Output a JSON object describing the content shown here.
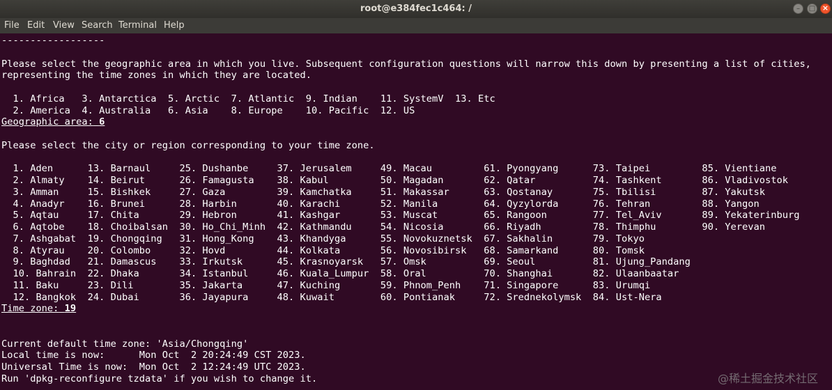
{
  "window": {
    "title": "root@e384fec1c464: /"
  },
  "menubar": {
    "items": [
      "File",
      "Edit",
      "View",
      "Search",
      "Terminal",
      "Help"
    ]
  },
  "terminal": {
    "lines": [
      "------------------",
      "",
      "Please select the geographic area in which you live. Subsequent configuration questions will narrow this down by presenting a list of cities,",
      "representing the time zones in which they are located.",
      "",
      "  1. Africa   3. Antarctica  5. Arctic  7. Atlantic  9. Indian    11. SystemV  13. Etc",
      "  2. America  4. Australia   6. Asia    8. Europe    10. Pacific  12. US",
      "",
      "",
      "Please select the city or region corresponding to your time zone.",
      "",
      "  1. Aden      13. Barnaul     25. Dushanbe     37. Jerusalem     49. Macau         61. Pyongyang      73. Taipei         85. Vientiane",
      "  2. Almaty    14. Beirut      26. Famagusta    38. Kabul         50. Magadan       62. Qatar          74. Tashkent       86. Vladivostok",
      "  3. Amman     15. Bishkek     27. Gaza         39. Kamchatka     51. Makassar      63. Qostanay       75. Tbilisi        87. Yakutsk",
      "  4. Anadyr    16. Brunei      28. Harbin       40. Karachi       52. Manila        64. Qyzylorda      76. Tehran         88. Yangon",
      "  5. Aqtau     17. Chita       29. Hebron       41. Kashgar       53. Muscat        65. Rangoon        77. Tel_Aviv       89. Yekaterinburg",
      "  6. Aqtobe    18. Choibalsan  30. Ho_Chi_Minh  42. Kathmandu     54. Nicosia       66. Riyadh         78. Thimphu        90. Yerevan",
      "  7. Ashgabat  19. Chongqing   31. Hong_Kong    43. Khandyga      55. Novokuznetsk  67. Sakhalin       79. Tokyo",
      "  8. Atyrau    20. Colombo     32. Hovd         44. Kolkata       56. Novosibirsk   68. Samarkand      80. Tomsk",
      "  9. Baghdad   21. Damascus    33. Irkutsk      45. Krasnoyarsk   57. Omsk          69. Seoul          81. Ujung_Pandang",
      "  10. Bahrain  22. Dhaka       34. Istanbul     46. Kuala_Lumpur  58. Oral          70. Shanghai       82. Ulaanbaatar",
      "  11. Baku     23. Dili        35. Jakarta      47. Kuching       59. Phnom_Penh    71. Singapore      83. Urumqi",
      "  12. Bangkok  24. Dubai       36. Jayapura     48. Kuwait        60. Pontianak     72. Srednekolymsk  84. Ust-Nera",
      "",
      "",
      "",
      "Current default time zone: 'Asia/Chongqing'",
      "Local time is now:      Mon Oct  2 20:24:49 CST 2023.",
      "Universal Time is now:  Mon Oct  2 12:24:49 UTC 2023.",
      "Run 'dpkg-reconfigure tzdata' if you wish to change it."
    ],
    "geo_prompt": "Geographic area:",
    "geo_answer": "6",
    "tz_prompt": "Time zone:",
    "tz_answer": "19"
  },
  "watermark": "@稀土掘金技术社区"
}
